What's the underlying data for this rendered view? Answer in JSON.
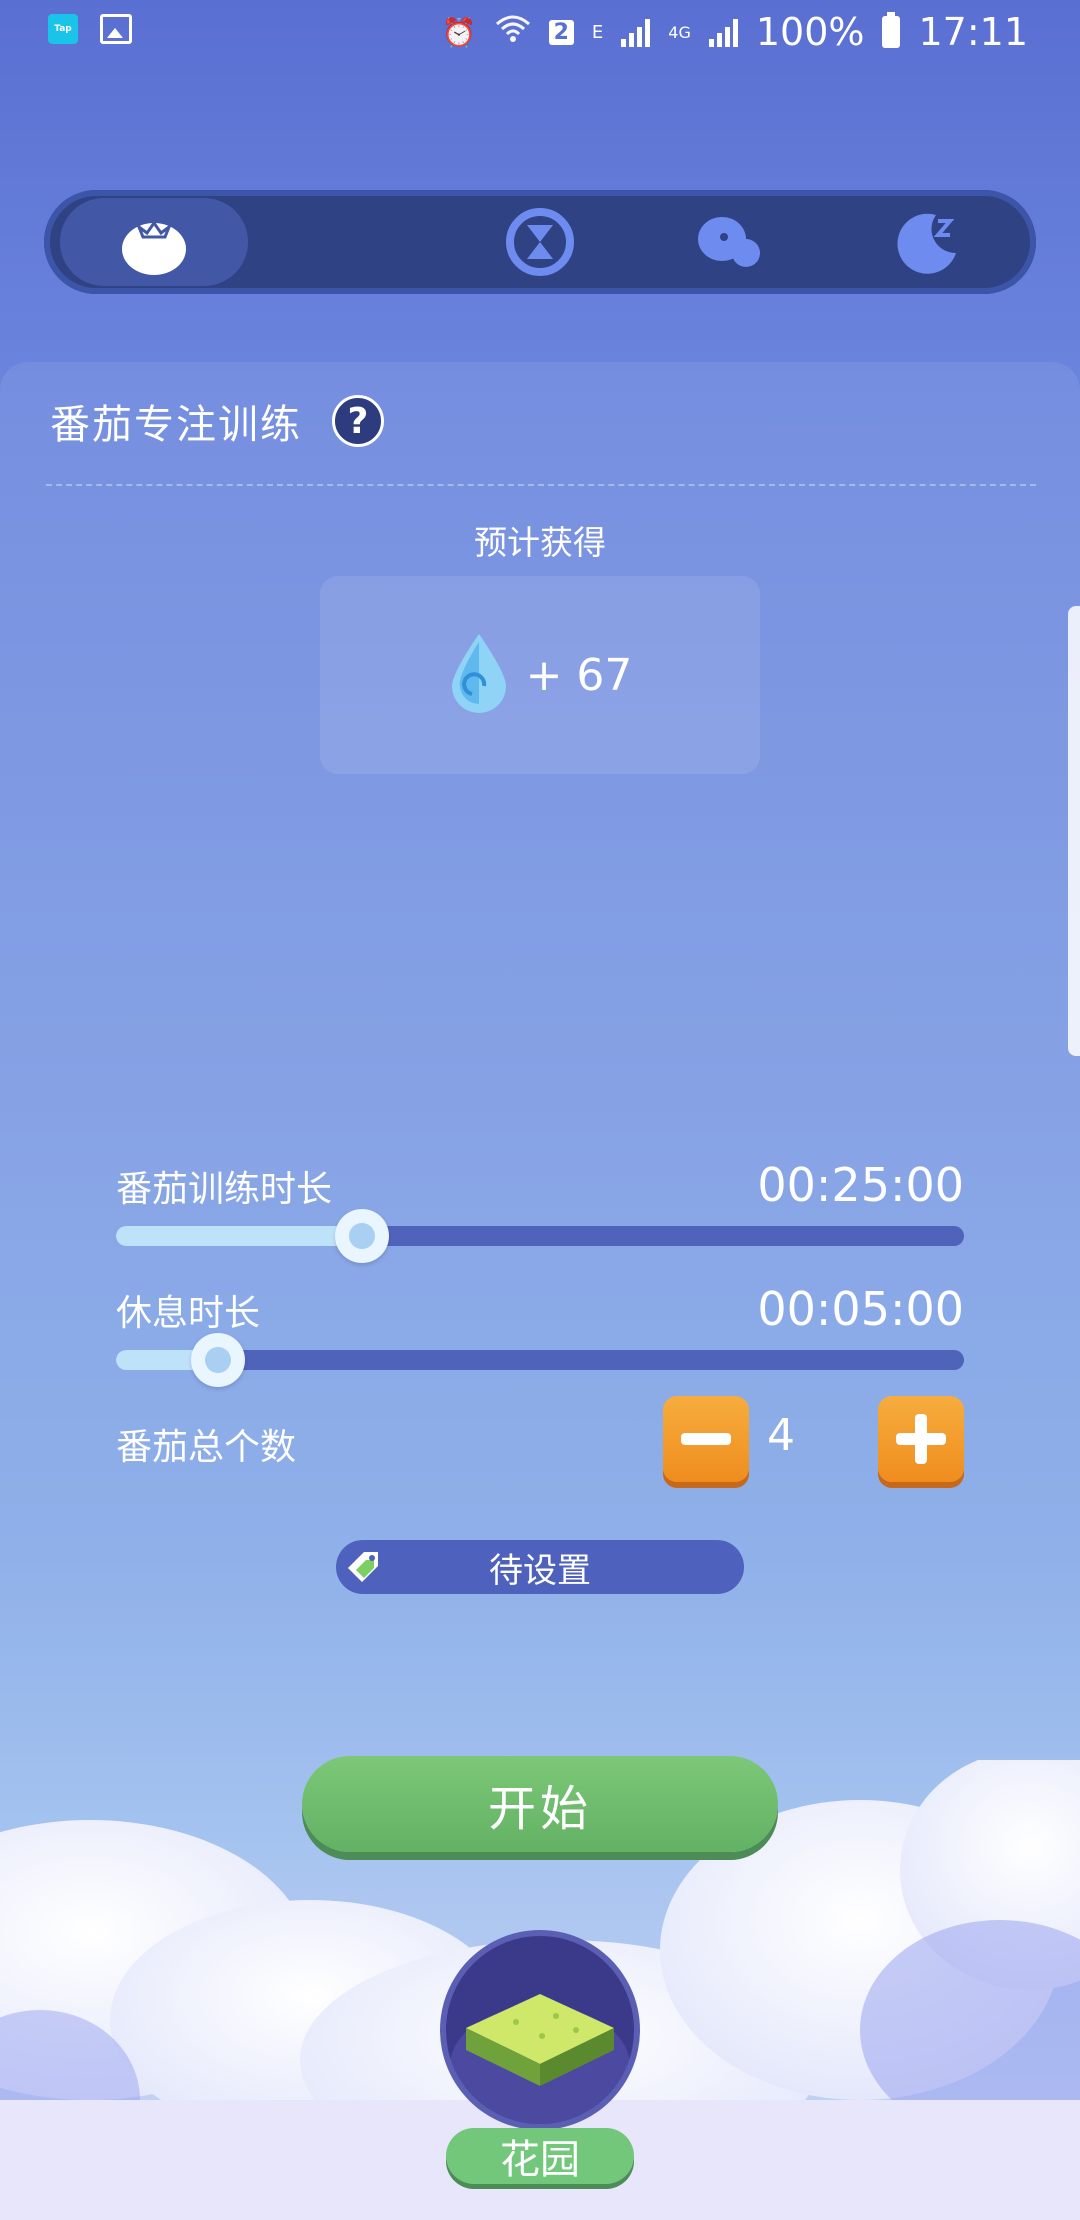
{
  "status_bar": {
    "app_icon_text": "Tap",
    "sim_badge": "2",
    "network_e": "E",
    "network_4g": "4G",
    "battery": "100%",
    "time": "17:11"
  },
  "mode_tabs": [
    {
      "name": "tomato",
      "icon": "tomato-icon",
      "active": true
    },
    {
      "name": "hourglass",
      "icon": "hourglass-icon",
      "active": false
    },
    {
      "name": "chat",
      "icon": "chat-bubbles-icon",
      "active": false
    },
    {
      "name": "sleep",
      "icon": "moon-icon",
      "active": false
    }
  ],
  "panel": {
    "title": "番茄专注训练",
    "help_label": "?",
    "estimate_label": "预计获得",
    "reward_value": "+ 67",
    "reward_icon": "water-drop-icon"
  },
  "settings": {
    "training_label": "番茄训练时长",
    "training_time": "00:25:00",
    "training_level": 0.29,
    "rest_label": "休息时长",
    "rest_time": "00:05:00",
    "rest_level": 0.12,
    "count_label": "番茄总个数",
    "count_value": "4"
  },
  "tag": {
    "label": "待设置",
    "icon": "tag-icon"
  },
  "start_label": "开始",
  "garden_label": "花园",
  "colors": {
    "accent_orange": "#f39a2c",
    "accent_green": "#6dbb6d",
    "track": "#4f63bb"
  }
}
